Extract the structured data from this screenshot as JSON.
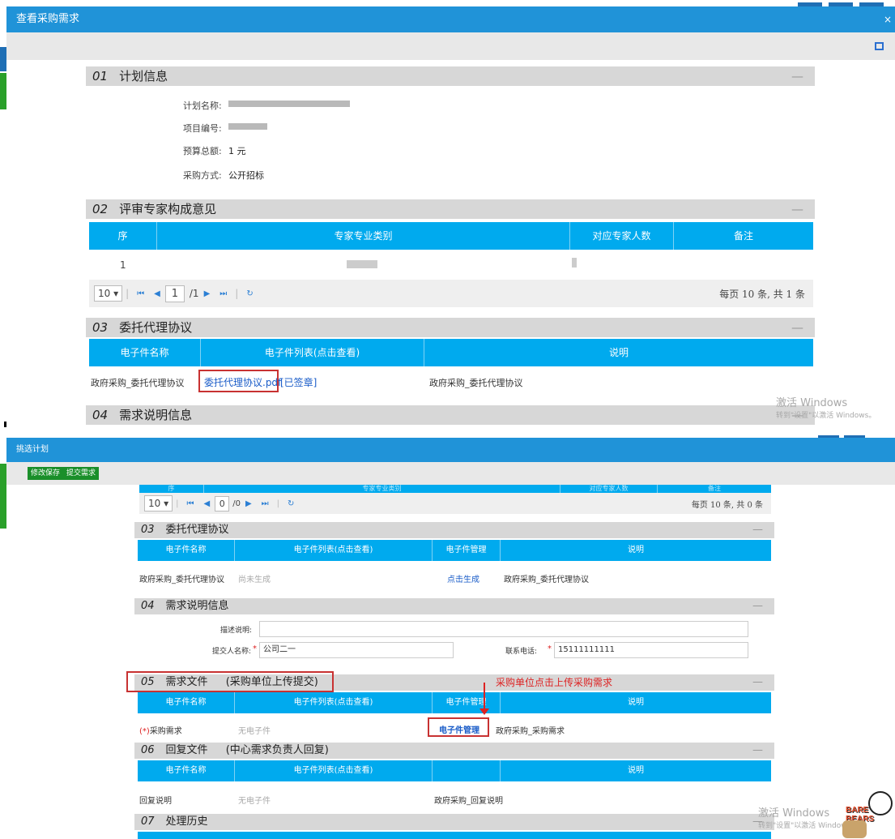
{
  "top": {
    "title": "查看采购需求",
    "close": "×",
    "sections": {
      "s01": {
        "num": "01",
        "title": "计划信息"
      },
      "s02": {
        "num": "02",
        "title": "评审专家构成意见"
      },
      "s03": {
        "num": "03",
        "title": "委托代理协议"
      },
      "s04": {
        "num": "04",
        "title": "需求说明信息"
      }
    },
    "plan": {
      "name_label": "计划名称:",
      "project_label": "项目编号:",
      "budget_label": "预算总额:",
      "budget_value": "1 元",
      "method_label": "采购方式:",
      "method_value": "公开招标"
    },
    "experts": {
      "headers": [
        "序",
        "专家专业类别",
        "对应专家人数",
        "备注"
      ],
      "row_index": "1"
    },
    "pager": {
      "page_size": "10",
      "page": "1",
      "total_pages": "/1",
      "info": "每页 10 条, 共 1 条"
    },
    "agreement": {
      "headers": [
        "电子件名称",
        "电子件列表(点击查看)",
        "说明"
      ],
      "name": "政府采购_委托代理协议",
      "file": "委托代理协议.pdf",
      "signed": "[已签章]",
      "desc": "政府采购_委托代理协议"
    },
    "watermark": {
      "line1": "激活 Windows",
      "line2": "转到\"设置\"以激活 Windows。"
    }
  },
  "bottom": {
    "title": "挑选计划",
    "buttons": {
      "save": "修改保存",
      "submit": "提交需求"
    },
    "pager": {
      "page_size": "10",
      "page": "0",
      "total_pages": "/0",
      "info": "每页 10 条, 共 0 条"
    },
    "headers_top": [
      "序",
      "专家专业类别",
      "对应专家人数",
      "备注"
    ],
    "sections": {
      "s03": {
        "num": "03",
        "title": "委托代理协议"
      },
      "s04": {
        "num": "04",
        "title": "需求说明信息"
      },
      "s05": {
        "num": "05",
        "title": "需求文件",
        "extra": "(采购单位上传提交)"
      },
      "s06": {
        "num": "06",
        "title": "回复文件",
        "extra": "(中心需求负责人回复)"
      },
      "s07": {
        "num": "07",
        "title": "处理历史"
      }
    },
    "agreement": {
      "headers": [
        "电子件名称",
        "电子件列表(点击查看)",
        "电子件管理",
        "说明"
      ],
      "name": "政府采购_委托代理协议",
      "file": "尚未生成",
      "manage": "点击生成",
      "desc": "政府采购_委托代理协议"
    },
    "demand_info": {
      "desc_label": "描述说明:",
      "submitter_label": "提交人名称:",
      "submitter_value": "公司二一",
      "phone_label": "联系电话:",
      "phone_value": "15111111111",
      "required": "*"
    },
    "demand_file": {
      "annotation": "采购单位点击上传采购需求",
      "headers": [
        "电子件名称",
        "电子件列表(点击查看)",
        "电子件管理",
        "说明"
      ],
      "required_mark": "(*)",
      "name": "采购需求",
      "file": "无电子件",
      "manage": "电子件管理",
      "desc": "政府采购_采购需求"
    },
    "reply_file": {
      "headers": [
        "电子件名称",
        "电子件列表(点击查看)",
        "",
        "说明"
      ],
      "name": "回复说明",
      "file": "无电子件",
      "desc": "政府采购_回复说明"
    },
    "watermark": {
      "line1": "激活 Windows",
      "line2": "转到\"设置\"以激活 Windows。"
    },
    "sticker": "BARE BEARS"
  },
  "colors": {
    "title_blue": "#2093d8",
    "grid_blue": "#00aaee",
    "section_gray": "#d7d7d7",
    "annot_red": "#d22222"
  }
}
